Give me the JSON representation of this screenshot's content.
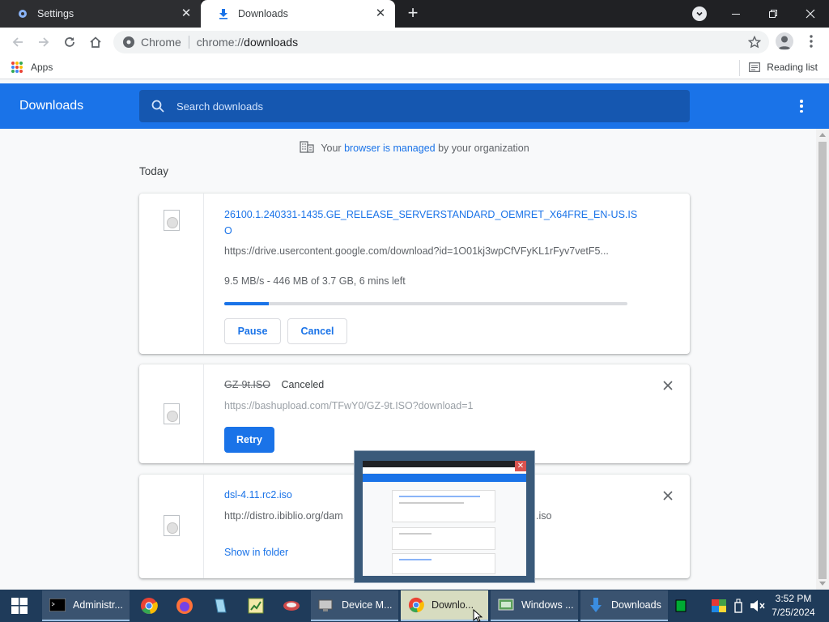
{
  "browser": {
    "tabs": [
      {
        "label": "Settings",
        "active": false
      },
      {
        "label": "Downloads",
        "active": true
      }
    ],
    "new_tab_symbol": "+",
    "omnibox": {
      "chip": "Chrome",
      "url_prefix": "chrome://",
      "url_path": "downloads"
    },
    "bookmarks": {
      "apps_label": "Apps",
      "reading_list_label": "Reading list"
    }
  },
  "downloads_page": {
    "title": "Downloads",
    "search_placeholder": "Search downloads",
    "managed_notice": {
      "prefix": "Your",
      "link": "browser is managed",
      "suffix": "by your organization"
    },
    "section_label": "Today",
    "items": [
      {
        "file_name_line1": "26100.1.240331-1435.GE_RELEASE_SERVERSTANDARD_OEMRET_X64FRE_EN-US.IS",
        "file_name_line2": "O",
        "url": "https://drive.usercontent.google.com/download?id=1O01kj3wpCfVFyKL1rFyv7vetF5...",
        "status": "9.5 MB/s - 446 MB of 3.7 GB, 6 mins left",
        "progress_fraction": 0.11,
        "buttons": [
          "Pause",
          "Cancel"
        ]
      },
      {
        "file_name": "GZ-9t.ISO",
        "state_label": "Canceled",
        "url": "https://bashupload.com/TFwY0/GZ-9t.ISO?download=1",
        "button": "Retry"
      },
      {
        "file_name": "dsl-4.11.rc2.iso",
        "url_visible_start": "http://distro.ibiblio.org/dam",
        "url_visible_end": ".iso",
        "link": "Show in folder"
      }
    ]
  },
  "taskbar": {
    "windows": [
      {
        "label": "Administr...",
        "icon": "cmd-icon"
      },
      {
        "label": "Device M...",
        "icon": "device-manager-icon"
      },
      {
        "label": "Downlo...",
        "icon": "chrome-icon",
        "highlighted": true
      },
      {
        "label": "Windows ...",
        "icon": "windows-app-icon"
      },
      {
        "label": "Downloads",
        "icon": "download-arrow-icon"
      }
    ],
    "clock": {
      "time": "3:52 PM",
      "date": "7/25/2024"
    }
  },
  "colors": {
    "accent": "#1a73e8",
    "tab_bar": "#202124",
    "taskbar": "#1f3b5a"
  }
}
